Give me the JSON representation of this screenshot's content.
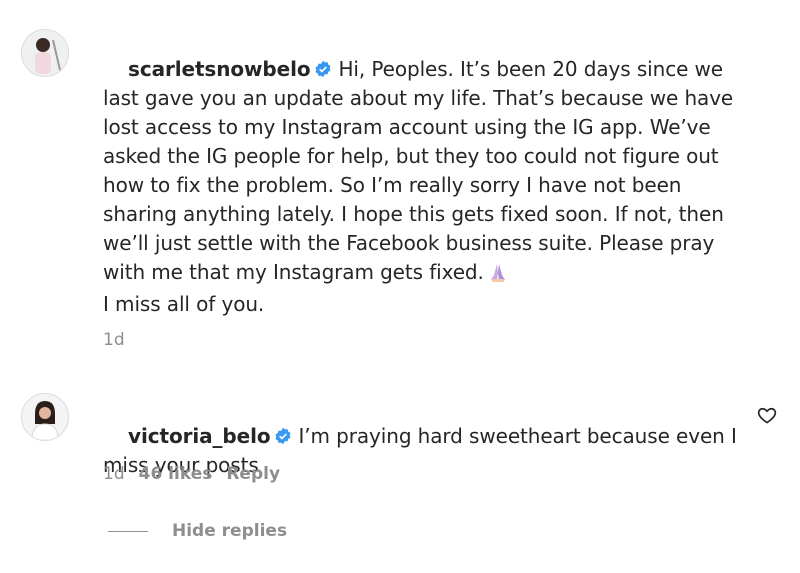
{
  "comments": [
    {
      "username": "scarletsnowbelo",
      "verified": true,
      "text_main": "Hi, Peoples. It’s been 20 days since we last gave you an update about my life. That’s because we have lost access to my Instagram account using the IG app. We’ve asked the IG people for help, but they too could not figure out how to fix the problem. So I’m really sorry I have not been sharing anything lately. I hope this gets fixed soon. If not, then we’ll just settle with the Facebook business suite. Please pray with me that my Instagram gets fixed.",
      "emoji_icon": "praying-hands-icon",
      "text_extra": "I miss all of you.",
      "time": "1d"
    }
  ],
  "reply": {
    "username": "victoria_belo",
    "verified": true,
    "text": "I’m praying hard sweetheart because even I miss your posts",
    "time": "1d",
    "likes": "46 likes",
    "reply_label": "Reply",
    "like_icon": "heart-icon"
  },
  "hide_replies_label": "Hide replies",
  "colors": {
    "verified": "#3897f0",
    "text": "#262626",
    "muted": "#8e8e8e"
  }
}
